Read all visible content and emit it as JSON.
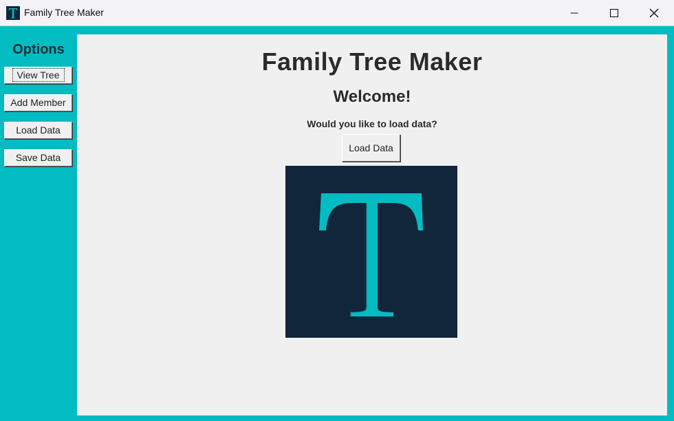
{
  "window": {
    "title": "Family Tree Maker",
    "icon": "app-logo-t-icon"
  },
  "sidebar": {
    "title": "Options",
    "buttons": [
      {
        "label": "View Tree"
      },
      {
        "label": "Add Member"
      },
      {
        "label": "Load Data"
      },
      {
        "label": "Save Data"
      }
    ]
  },
  "main": {
    "title": "Family Tree Maker",
    "welcome": "Welcome!",
    "question": "Would you like to load data?",
    "load_button_label": "Load Data",
    "logo_letter": "T"
  },
  "colors": {
    "accent": "#03bcc2",
    "logo_background": "#12263b",
    "panel_background": "#f0f0f0"
  }
}
